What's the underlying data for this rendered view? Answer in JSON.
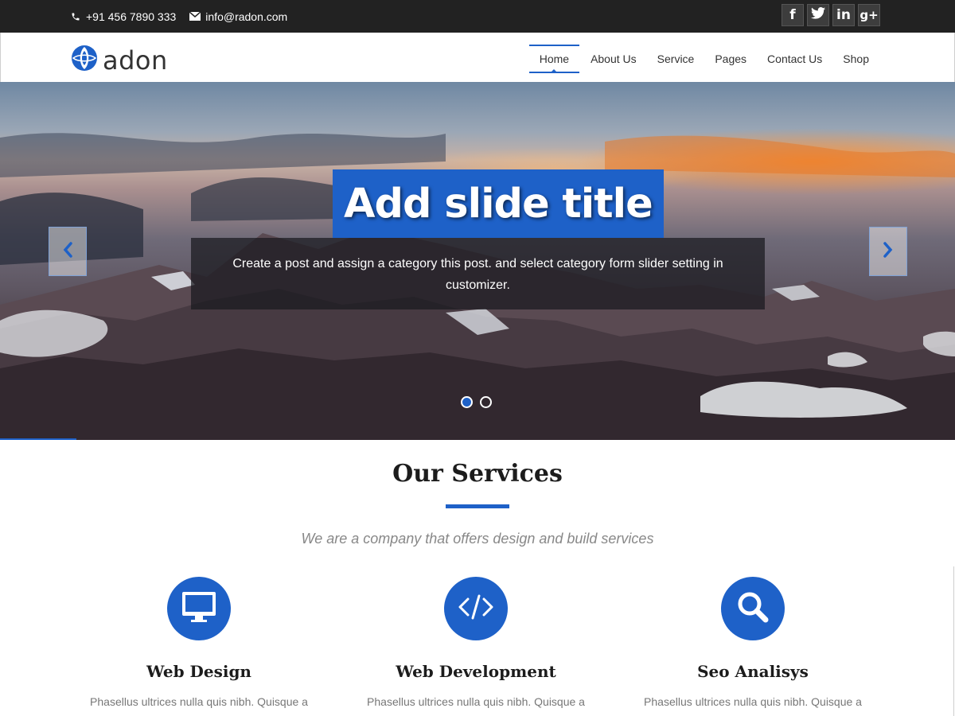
{
  "topbar": {
    "phone": "+91 456 7890 333",
    "email": "info@radon.com",
    "social": [
      {
        "label": "f",
        "icon": "facebook-icon"
      },
      {
        "label": "",
        "icon": "twitter-icon"
      },
      {
        "label": "in",
        "icon": "linkedin-icon"
      },
      {
        "label": "g+",
        "icon": "google-plus-icon"
      }
    ]
  },
  "header": {
    "logo_text": "adon",
    "nav": [
      {
        "label": "Home",
        "active": true
      },
      {
        "label": "About Us"
      },
      {
        "label": "Service"
      },
      {
        "label": "Pages"
      },
      {
        "label": "Contact Us"
      },
      {
        "label": "Shop"
      }
    ]
  },
  "hero": {
    "slide_title": "Add slide title",
    "slide_description": "Create a post and assign a category this post. and select category form slider setting in customizer.",
    "slides_count": 2,
    "active_slide": 1
  },
  "services": {
    "title": "Our Services",
    "subtitle": "We are a company that offers design and build services",
    "items": [
      {
        "name": "Web Design",
        "icon": "monitor-icon",
        "desc": "Phasellus ultrices nulla quis nibh. Quisque a"
      },
      {
        "name": "Web Development",
        "icon": "code-icon",
        "desc": "Phasellus ultrices nulla quis nibh. Quisque a"
      },
      {
        "name": "Seo Analisys",
        "icon": "search-icon",
        "desc": "Phasellus ultrices nulla quis nibh. Quisque a"
      }
    ]
  },
  "colors": {
    "accent": "#1e61c8",
    "topbar": "#222222"
  }
}
